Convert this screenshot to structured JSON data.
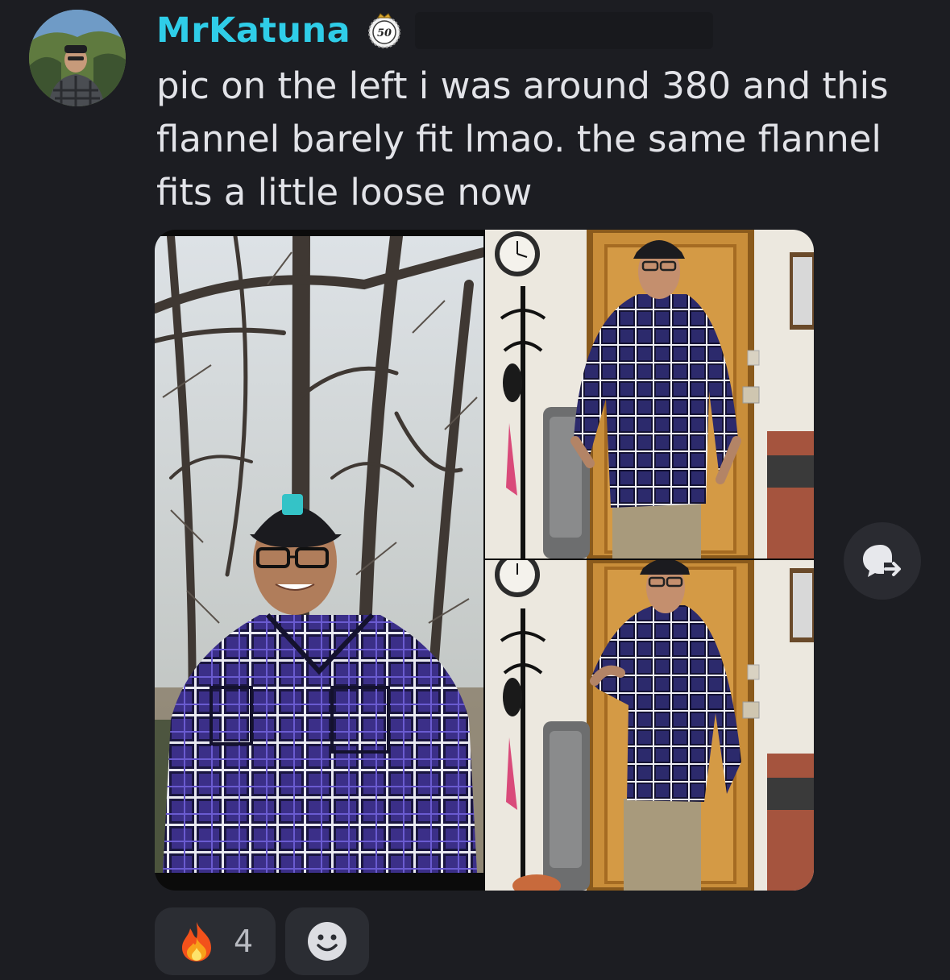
{
  "message": {
    "author": {
      "username": "MrKatuna",
      "username_color": "#2fcde8",
      "avatar_icon": "avatar-photo",
      "badge_icon": "crown-badge-icon",
      "badge_number": "50"
    },
    "content": "pic on the left i was around 380 and this flannel barely fit lmao. the same flannel fits a little loose now",
    "attachments": [
      {
        "name": "before-photo",
        "description_icon": "image"
      },
      {
        "name": "after-photo-front",
        "description_icon": "image"
      },
      {
        "name": "after-photo-side",
        "description_icon": "image"
      }
    ],
    "thread_button_icon": "thread-reply-icon",
    "reactions": [
      {
        "emoji_icon": "fire-emoji-icon",
        "count": "4"
      }
    ],
    "add_reaction_icon": "smiley-add-reaction-icon"
  },
  "colors": {
    "background": "#1c1d22",
    "text": "#e2e3e8",
    "pill": "#2b2d33",
    "reaction_count": "#b8bac1"
  }
}
